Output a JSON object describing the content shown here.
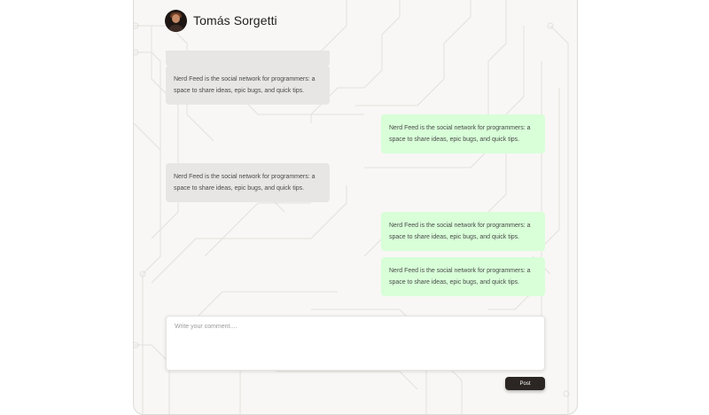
{
  "header": {
    "username": "Tomás Sorgetti",
    "avatar_icon": "user-avatar-icon"
  },
  "messages": [
    {
      "direction": "incoming",
      "text": "Nerd Feed is the social network for programmers: a space to share ideas, epic bugs, and quick tips."
    },
    {
      "direction": "outgoing",
      "text": "Nerd Feed is the social network for programmers: a space to share ideas, epic bugs, and quick tips."
    },
    {
      "direction": "incoming",
      "text": "Nerd Feed is the social network for programmers: a space to share ideas, epic bugs, and quick tips."
    },
    {
      "direction": "outgoing",
      "text": "Nerd Feed is the social network for programmers: a space to share ideas, epic bugs, and quick tips."
    },
    {
      "direction": "outgoing",
      "text": "Nerd Feed is the social network for programmers: a space to share ideas, epic bugs, and quick tips."
    }
  ],
  "composer": {
    "placeholder": "Write your comment....",
    "post_label": "Post"
  },
  "colors": {
    "incoming_bubble": "#e7e6e4",
    "outgoing_bubble": "#d8ffd8",
    "panel_background": "#f8f7f5",
    "post_button": "#2b2623"
  }
}
